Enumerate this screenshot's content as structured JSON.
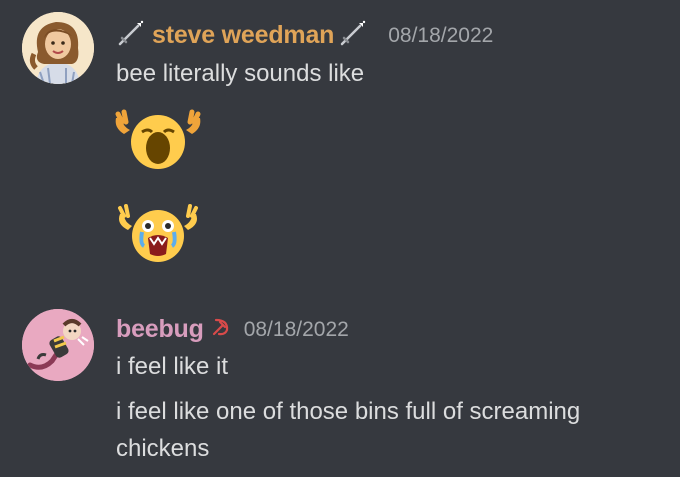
{
  "messages": [
    {
      "username": "steve weedman",
      "username_color": "#e0a458",
      "timestamp": "08/18/2022",
      "avatar_icon": "avatar-woman-icon",
      "tag_icons": [
        "sword-icon",
        "sword-icon"
      ],
      "lines": [
        "bee literally sounds like"
      ],
      "emojis": [
        "screaming-face-emoji",
        "crying-screaming-face-emoji"
      ]
    },
    {
      "username": "beebug",
      "username_color": "#d89dbd",
      "timestamp": "08/18/2022",
      "avatar_icon": "avatar-bee-character-icon",
      "tag_icons": [
        "hammer-sickle-icon"
      ],
      "lines": [
        "i feel like it",
        "i feel like one of those bins full of screaming chickens"
      ]
    }
  ],
  "colors": {
    "background": "#36393f",
    "text": "#dcddde",
    "timestamp": "#a3a6aa"
  }
}
